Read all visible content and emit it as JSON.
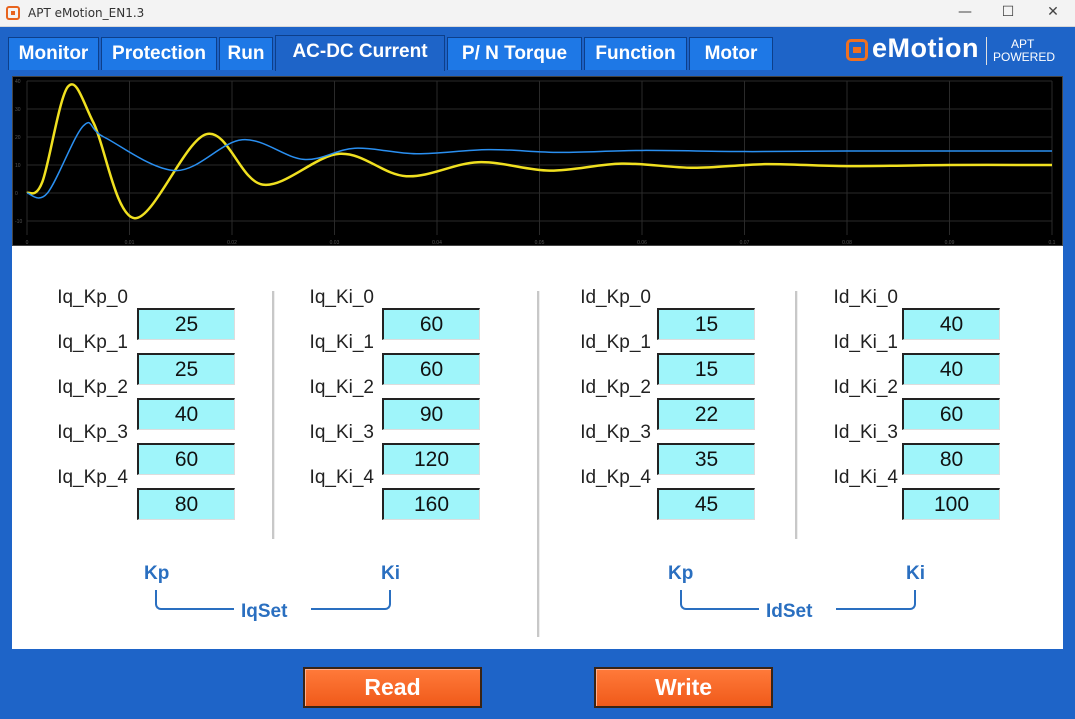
{
  "window": {
    "title": "APT eMotion_EN1.3",
    "min_glyph": "—",
    "max_glyph": "☐",
    "close_glyph": "✕"
  },
  "tabs": [
    {
      "label": "Monitor",
      "active": false
    },
    {
      "label": "Protection",
      "active": false
    },
    {
      "label": "Run",
      "active": false
    },
    {
      "label": "AC-DC Current",
      "active": true
    },
    {
      "label": "P/ N Torque",
      "active": false
    },
    {
      "label": "Function",
      "active": false
    },
    {
      "label": "Motor",
      "active": false
    }
  ],
  "logo": {
    "text": "eMotion",
    "sub1": "APT",
    "sub2": "POWERED"
  },
  "colors": {
    "frame": "#1e64c8",
    "tab": "#1e78e6",
    "value_bg": "#9ff5fa",
    "group_label": "#2a6fc0",
    "button": "#f05a1a",
    "series_yellow": "#f0e020",
    "series_blue": "#2a8ff0"
  },
  "chart_data": {
    "type": "line",
    "title": "",
    "xlabel": "",
    "ylabel": "",
    "xlim": [
      0,
      0.1
    ],
    "ylim": [
      -15,
      40
    ],
    "y_ticks": [
      -10,
      0,
      10,
      20,
      30,
      40
    ],
    "x_ticks": [
      0,
      0.01,
      0.02,
      0.03,
      0.04,
      0.05,
      0.06,
      0.07,
      0.08,
      0.09,
      0.1
    ],
    "grid": true,
    "series": [
      {
        "color": "#f0e020",
        "x": [
          0,
          0.0015,
          0.004,
          0.0065,
          0.0105,
          0.0175,
          0.023,
          0.0305,
          0.037,
          0.044,
          0.051,
          0.058,
          0.065,
          0.072,
          0.08,
          0.09,
          0.1
        ],
        "y": [
          0,
          4,
          38,
          25,
          -9,
          21,
          3,
          14,
          6,
          11,
          8,
          10.5,
          9,
          10.3,
          9.6,
          10,
          10
        ]
      },
      {
        "color": "#2a8ff0",
        "x": [
          0,
          0.002,
          0.0055,
          0.0075,
          0.0145,
          0.021,
          0.027,
          0.032,
          0.038,
          0.045,
          0.052,
          0.06,
          0.07,
          0.08,
          0.09,
          0.1
        ],
        "y": [
          0,
          0,
          24,
          20,
          8,
          19,
          12,
          16,
          14,
          15.5,
          14.5,
          15.2,
          14.8,
          15,
          15,
          15
        ]
      }
    ]
  },
  "groups": {
    "iq_kp": {
      "labels": [
        "Iq_Kp_0",
        "Iq_Kp_1",
        "Iq_Kp_2",
        "Iq_Kp_3",
        "Iq_Kp_4"
      ],
      "values": [
        "25",
        "25",
        "40",
        "60",
        "80"
      ]
    },
    "iq_ki": {
      "labels": [
        "Iq_Ki_0",
        "Iq_Ki_1",
        "Iq_Ki_2",
        "Iq_Ki_3",
        "Iq_Ki_4"
      ],
      "values": [
        "60",
        "60",
        "90",
        "120",
        "160"
      ]
    },
    "id_kp": {
      "labels": [
        "Id_Kp_0",
        "Id_Kp_1",
        "Id_Kp_2",
        "Id_Kp_3",
        "Id_Kp_4"
      ],
      "values": [
        "15",
        "15",
        "22",
        "35",
        "45"
      ]
    },
    "id_ki": {
      "labels": [
        "Id_Ki_0",
        "Id_Ki_1",
        "Id_Ki_2",
        "Id_Ki_3",
        "Id_Ki_4"
      ],
      "values": [
        "40",
        "40",
        "60",
        "80",
        "100"
      ]
    }
  },
  "bracket_labels": {
    "iq": {
      "kp": "Kp",
      "ki": "Ki",
      "set": "IqSet"
    },
    "id": {
      "kp": "Kp",
      "ki": "Ki",
      "set": "IdSet"
    }
  },
  "buttons": {
    "read": "Read",
    "write": "Write"
  }
}
